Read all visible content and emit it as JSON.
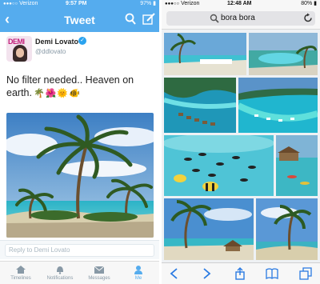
{
  "left": {
    "status": {
      "carrier": "Verizon",
      "time": "9:57 PM",
      "battery": "97%"
    },
    "nav": {
      "title": "Tweet",
      "back_icon": "chevron-left-icon",
      "search_icon": "search-icon",
      "compose_icon": "compose-icon"
    },
    "tweet": {
      "avatar_text": "DEMI",
      "name": "Demi Lovato",
      "handle": "@ddlovato",
      "text": "No filter needed.. Heaven on earth.",
      "emojis": "🌴🌺🌞🐠"
    },
    "reply_placeholder": "Reply to Demi Lovato",
    "tabs": [
      {
        "label": "Timelines",
        "icon": "home-icon",
        "active": false
      },
      {
        "label": "Notifications",
        "icon": "bell-icon",
        "active": false
      },
      {
        "label": "Messages",
        "icon": "envelope-icon",
        "active": false
      },
      {
        "label": "Me",
        "icon": "person-icon",
        "active": true
      }
    ],
    "colors": {
      "brand": "#55acee",
      "verified": "#2aa3ef"
    }
  },
  "right": {
    "status": {
      "carrier": "Verizon",
      "time": "12:48 AM",
      "battery": "80%"
    },
    "search": {
      "query": "bora bora"
    },
    "results": [
      "bora-bora-result-1",
      "bora-bora-result-2",
      "bora-bora-result-3",
      "bora-bora-result-4",
      "bora-bora-result-5",
      "bora-bora-result-6",
      "bora-bora-result-7",
      "bora-bora-result-8"
    ],
    "toolbar": [
      "back-icon",
      "forward-icon",
      "share-icon",
      "bookmarks-icon",
      "tabs-icon"
    ]
  }
}
